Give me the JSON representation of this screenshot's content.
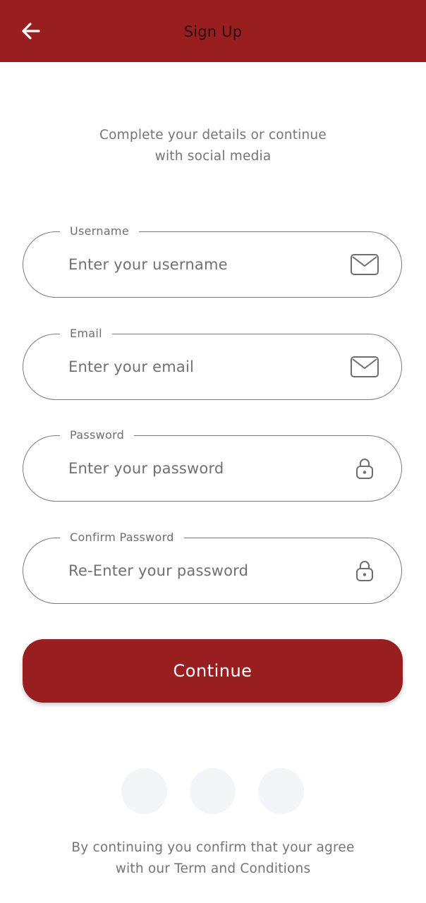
{
  "header": {
    "title": "Sign Up",
    "back_icon": "arrow-left-icon",
    "background_color": "#981e1f"
  },
  "intro": {
    "line1": "Complete your details or continue",
    "line2": "with social media"
  },
  "form": {
    "username": {
      "label": "Username",
      "placeholder": "Enter your username",
      "icon": "mail-icon"
    },
    "email": {
      "label": "Email",
      "placeholder": "Enter your email",
      "icon": "mail-icon"
    },
    "password": {
      "label": "Password",
      "placeholder": "Enter your password",
      "icon": "lock-icon"
    },
    "confirm_password": {
      "label": "Confirm Password",
      "placeholder": "Re-Enter your password",
      "icon": "lock-icon"
    }
  },
  "continue_button": {
    "label": "Continue",
    "color": "#981e1f"
  },
  "social": {
    "buttons": [
      "social-button-1",
      "social-button-2",
      "social-button-3"
    ],
    "button_color": "#f4f5f9"
  },
  "terms": {
    "line1": "By continuing you confirm that your agree",
    "line2": "with our Term and Conditions"
  }
}
